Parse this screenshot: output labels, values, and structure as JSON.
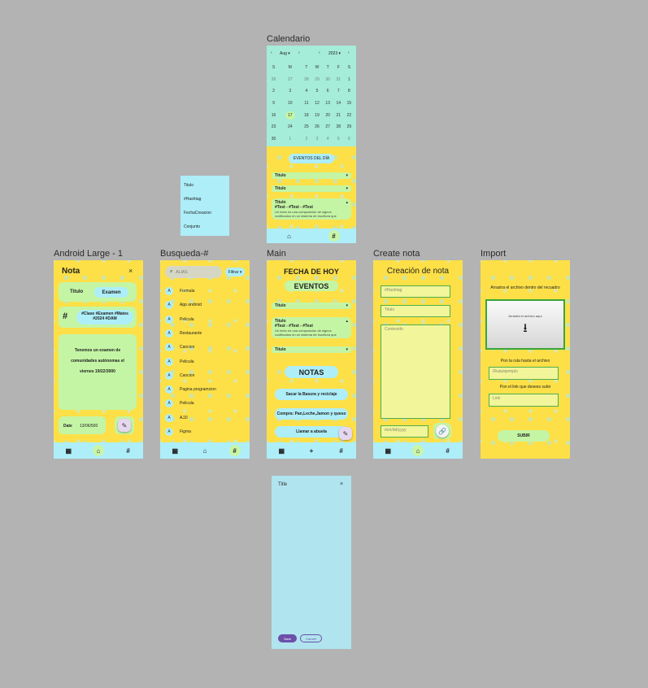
{
  "labels": {
    "calendario": "Calendario",
    "android": "Android Large - 1",
    "busqueda": "Busqueda-#",
    "main": "Main",
    "create": "Create nota",
    "import": "Import"
  },
  "dropdown_menu": {
    "items": [
      "Titulo",
      "#Hashtag",
      "FechaCreacion",
      "Conjunto"
    ]
  },
  "calendar": {
    "month": "Aug",
    "year": "2023",
    "weekdays": [
      "S",
      "M",
      "T",
      "W",
      "T",
      "F",
      "S"
    ],
    "weeks": [
      [
        "26",
        "27",
        "28",
        "29",
        "30",
        "31",
        "1"
      ],
      [
        "2",
        "3",
        "4",
        "5",
        "6",
        "7",
        "8"
      ],
      [
        "9",
        "10",
        "11",
        "12",
        "13",
        "14",
        "15"
      ],
      [
        "16",
        "17",
        "18",
        "19",
        "20",
        "21",
        "22"
      ],
      [
        "23",
        "24",
        "25",
        "26",
        "27",
        "28",
        "29"
      ],
      [
        "30",
        "1",
        "2",
        "3",
        "4",
        "5",
        "6"
      ]
    ],
    "selected": "17",
    "events_button": "EVENTOS DEL DÍA",
    "bar1": "Titulo",
    "bar2": "Titulo",
    "card_title": "Titulo",
    "card_tags": "#Test - #Test - #Test",
    "card_body": "Un texto es una composición de signos codificados en un sistema de escritura que"
  },
  "nota": {
    "title": "Nota",
    "close": "×",
    "tab_titulo": "Titulo",
    "tab_examen": "Examen",
    "hash": "#",
    "tags": "#Clase #Examen #Mates #2024 #DAM",
    "body": "Tenemos un examen de comunidades autónomas el viernes 19/22/3000",
    "date_label": "Date",
    "date_value": "13/06/500"
  },
  "busqueda": {
    "placeholder": "ALIAS",
    "filter": "Filtrar",
    "avatar_letter": "A",
    "items": [
      "Formula",
      "App android",
      "Pelicula",
      "Restaurante",
      "Cancion",
      "Pelicula",
      "Cancion",
      "Pagina programcion",
      "Pelicula",
      "AJJI",
      "Figma"
    ]
  },
  "main": {
    "heading": "FECHA DE HOY",
    "eventos": "EVENTOS",
    "bar1": "Titulo",
    "card_title": "Titulo",
    "card_tags": "#Test - #Test - #Test",
    "card_body": "Un texto es una composición de signos codificados en un sistema de escritura que",
    "bar2": "Titulo",
    "notas": "NOTAS",
    "notes": [
      "Sacar la Basura y reciclaje",
      "Compra: Pan,Leche,Jamon y queso",
      "Llamar a abuela"
    ]
  },
  "create": {
    "heading": "Creación de nota",
    "hashtag_ph": "#Hashtag",
    "titulo_ph": "Titulo",
    "contenido_ph": "Contenido",
    "date_ph": "mm/dd/yyyy"
  },
  "import": {
    "instruction": "Arrastra el archivo dentro del recuadro",
    "drop_text": "Arrastra el archivo aquí",
    "path_label": "Pon la ruta hasta el archivo",
    "path_ph": "/Ruta/ejemplo",
    "link_label": "Pon el link que desees subir",
    "link_ph": "Link",
    "submit": "SUBIR"
  },
  "dialog": {
    "title": "Title",
    "save": "Save",
    "cancel": "Cancel"
  },
  "colors": {
    "background": "#b3b3b3",
    "yellow": "#fde047",
    "cyan": "#aeeef9",
    "green": "#c4f5a5",
    "mint": "#a5ecd9",
    "dialog": "#b0e4ee"
  }
}
